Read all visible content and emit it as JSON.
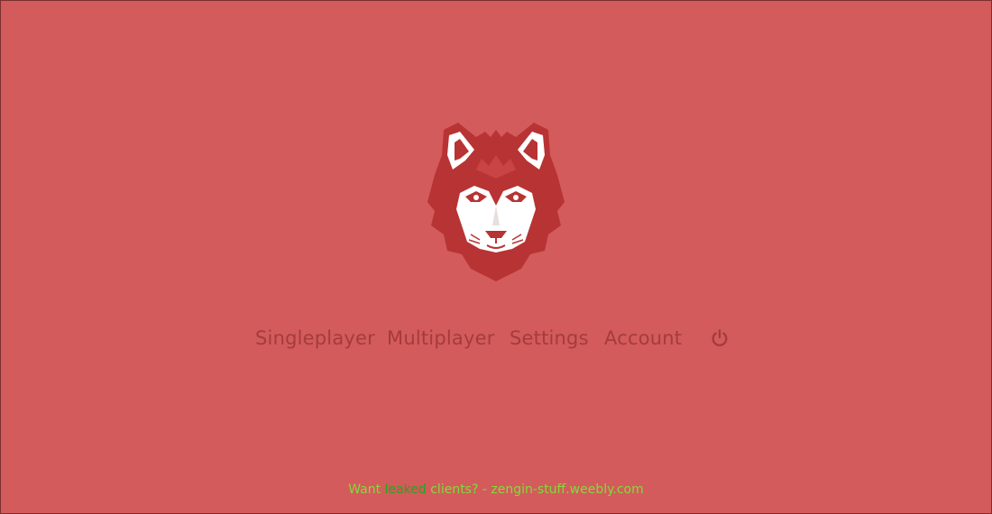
{
  "colors": {
    "background": "#d45b5b",
    "menu_text": "#a43c3c",
    "footer_text": "#7fdc3a",
    "footer_highlight": "#1ea81e",
    "logo_dark": "#b83333",
    "logo_light": "#ffffff"
  },
  "logo": {
    "icon": "wolf-head-icon"
  },
  "menu": {
    "items": [
      {
        "label": "Singleplayer"
      },
      {
        "label": "Multiplayer"
      },
      {
        "label": "Settings"
      },
      {
        "label": "Account"
      }
    ],
    "power_icon": "power-icon"
  },
  "footer": {
    "prefix": "Want ",
    "highlight": "leaked",
    "suffix": " clients? - zengin-stuff.weebly.com"
  }
}
